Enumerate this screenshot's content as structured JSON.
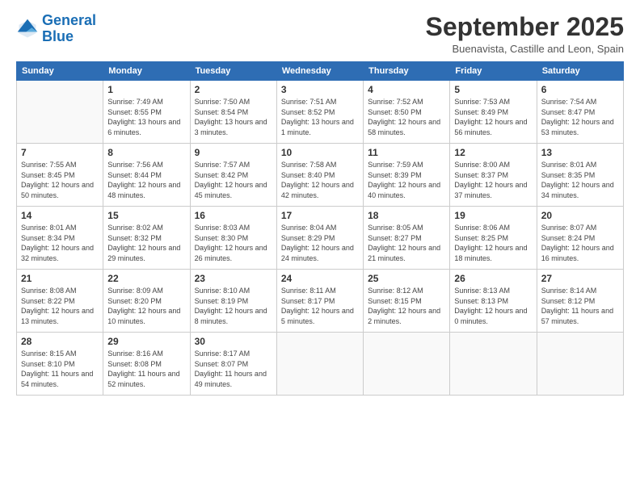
{
  "logo": {
    "line1": "General",
    "line2": "Blue"
  },
  "title": "September 2025",
  "subtitle": "Buenavista, Castille and Leon, Spain",
  "headers": [
    "Sunday",
    "Monday",
    "Tuesday",
    "Wednesday",
    "Thursday",
    "Friday",
    "Saturday"
  ],
  "weeks": [
    [
      {
        "day": "",
        "sunrise": "",
        "sunset": "",
        "daylight": ""
      },
      {
        "day": "1",
        "sunrise": "Sunrise: 7:49 AM",
        "sunset": "Sunset: 8:55 PM",
        "daylight": "Daylight: 13 hours and 6 minutes."
      },
      {
        "day": "2",
        "sunrise": "Sunrise: 7:50 AM",
        "sunset": "Sunset: 8:54 PM",
        "daylight": "Daylight: 13 hours and 3 minutes."
      },
      {
        "day": "3",
        "sunrise": "Sunrise: 7:51 AM",
        "sunset": "Sunset: 8:52 PM",
        "daylight": "Daylight: 13 hours and 1 minute."
      },
      {
        "day": "4",
        "sunrise": "Sunrise: 7:52 AM",
        "sunset": "Sunset: 8:50 PM",
        "daylight": "Daylight: 12 hours and 58 minutes."
      },
      {
        "day": "5",
        "sunrise": "Sunrise: 7:53 AM",
        "sunset": "Sunset: 8:49 PM",
        "daylight": "Daylight: 12 hours and 56 minutes."
      },
      {
        "day": "6",
        "sunrise": "Sunrise: 7:54 AM",
        "sunset": "Sunset: 8:47 PM",
        "daylight": "Daylight: 12 hours and 53 minutes."
      }
    ],
    [
      {
        "day": "7",
        "sunrise": "Sunrise: 7:55 AM",
        "sunset": "Sunset: 8:45 PM",
        "daylight": "Daylight: 12 hours and 50 minutes."
      },
      {
        "day": "8",
        "sunrise": "Sunrise: 7:56 AM",
        "sunset": "Sunset: 8:44 PM",
        "daylight": "Daylight: 12 hours and 48 minutes."
      },
      {
        "day": "9",
        "sunrise": "Sunrise: 7:57 AM",
        "sunset": "Sunset: 8:42 PM",
        "daylight": "Daylight: 12 hours and 45 minutes."
      },
      {
        "day": "10",
        "sunrise": "Sunrise: 7:58 AM",
        "sunset": "Sunset: 8:40 PM",
        "daylight": "Daylight: 12 hours and 42 minutes."
      },
      {
        "day": "11",
        "sunrise": "Sunrise: 7:59 AM",
        "sunset": "Sunset: 8:39 PM",
        "daylight": "Daylight: 12 hours and 40 minutes."
      },
      {
        "day": "12",
        "sunrise": "Sunrise: 8:00 AM",
        "sunset": "Sunset: 8:37 PM",
        "daylight": "Daylight: 12 hours and 37 minutes."
      },
      {
        "day": "13",
        "sunrise": "Sunrise: 8:01 AM",
        "sunset": "Sunset: 8:35 PM",
        "daylight": "Daylight: 12 hours and 34 minutes."
      }
    ],
    [
      {
        "day": "14",
        "sunrise": "Sunrise: 8:01 AM",
        "sunset": "Sunset: 8:34 PM",
        "daylight": "Daylight: 12 hours and 32 minutes."
      },
      {
        "day": "15",
        "sunrise": "Sunrise: 8:02 AM",
        "sunset": "Sunset: 8:32 PM",
        "daylight": "Daylight: 12 hours and 29 minutes."
      },
      {
        "day": "16",
        "sunrise": "Sunrise: 8:03 AM",
        "sunset": "Sunset: 8:30 PM",
        "daylight": "Daylight: 12 hours and 26 minutes."
      },
      {
        "day": "17",
        "sunrise": "Sunrise: 8:04 AM",
        "sunset": "Sunset: 8:29 PM",
        "daylight": "Daylight: 12 hours and 24 minutes."
      },
      {
        "day": "18",
        "sunrise": "Sunrise: 8:05 AM",
        "sunset": "Sunset: 8:27 PM",
        "daylight": "Daylight: 12 hours and 21 minutes."
      },
      {
        "day": "19",
        "sunrise": "Sunrise: 8:06 AM",
        "sunset": "Sunset: 8:25 PM",
        "daylight": "Daylight: 12 hours and 18 minutes."
      },
      {
        "day": "20",
        "sunrise": "Sunrise: 8:07 AM",
        "sunset": "Sunset: 8:24 PM",
        "daylight": "Daylight: 12 hours and 16 minutes."
      }
    ],
    [
      {
        "day": "21",
        "sunrise": "Sunrise: 8:08 AM",
        "sunset": "Sunset: 8:22 PM",
        "daylight": "Daylight: 12 hours and 13 minutes."
      },
      {
        "day": "22",
        "sunrise": "Sunrise: 8:09 AM",
        "sunset": "Sunset: 8:20 PM",
        "daylight": "Daylight: 12 hours and 10 minutes."
      },
      {
        "day": "23",
        "sunrise": "Sunrise: 8:10 AM",
        "sunset": "Sunset: 8:19 PM",
        "daylight": "Daylight: 12 hours and 8 minutes."
      },
      {
        "day": "24",
        "sunrise": "Sunrise: 8:11 AM",
        "sunset": "Sunset: 8:17 PM",
        "daylight": "Daylight: 12 hours and 5 minutes."
      },
      {
        "day": "25",
        "sunrise": "Sunrise: 8:12 AM",
        "sunset": "Sunset: 8:15 PM",
        "daylight": "Daylight: 12 hours and 2 minutes."
      },
      {
        "day": "26",
        "sunrise": "Sunrise: 8:13 AM",
        "sunset": "Sunset: 8:13 PM",
        "daylight": "Daylight: 12 hours and 0 minutes."
      },
      {
        "day": "27",
        "sunrise": "Sunrise: 8:14 AM",
        "sunset": "Sunset: 8:12 PM",
        "daylight": "Daylight: 11 hours and 57 minutes."
      }
    ],
    [
      {
        "day": "28",
        "sunrise": "Sunrise: 8:15 AM",
        "sunset": "Sunset: 8:10 PM",
        "daylight": "Daylight: 11 hours and 54 minutes."
      },
      {
        "day": "29",
        "sunrise": "Sunrise: 8:16 AM",
        "sunset": "Sunset: 8:08 PM",
        "daylight": "Daylight: 11 hours and 52 minutes."
      },
      {
        "day": "30",
        "sunrise": "Sunrise: 8:17 AM",
        "sunset": "Sunset: 8:07 PM",
        "daylight": "Daylight: 11 hours and 49 minutes."
      },
      {
        "day": "",
        "sunrise": "",
        "sunset": "",
        "daylight": ""
      },
      {
        "day": "",
        "sunrise": "",
        "sunset": "",
        "daylight": ""
      },
      {
        "day": "",
        "sunrise": "",
        "sunset": "",
        "daylight": ""
      },
      {
        "day": "",
        "sunrise": "",
        "sunset": "",
        "daylight": ""
      }
    ]
  ]
}
